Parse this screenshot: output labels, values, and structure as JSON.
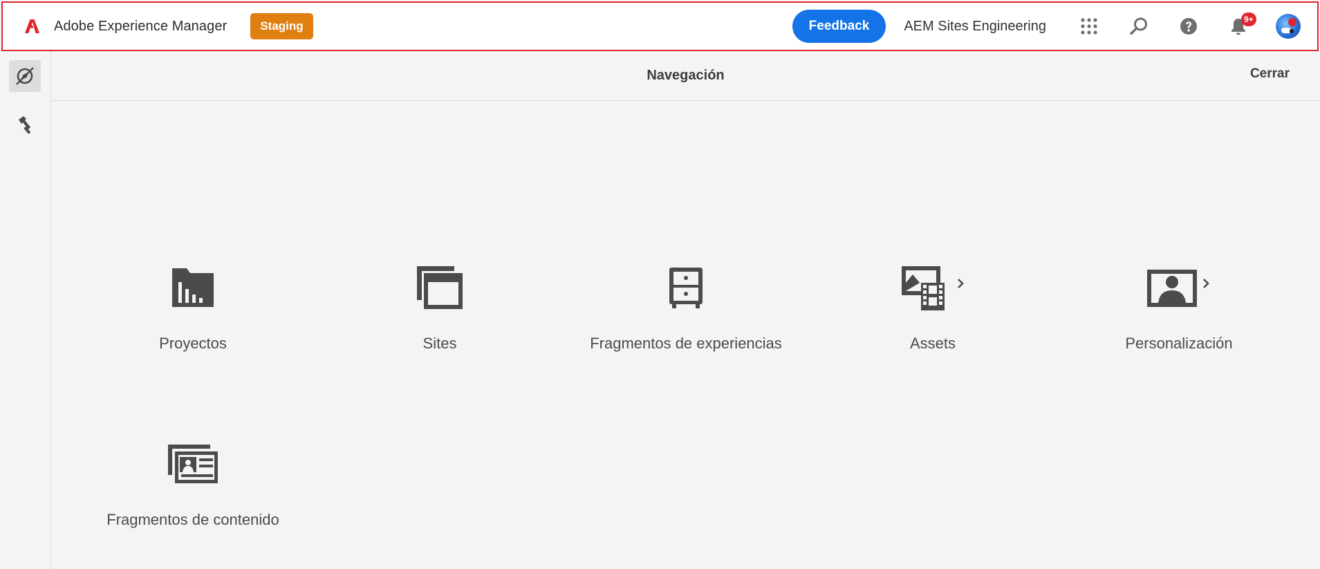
{
  "header": {
    "product_name": "Adobe Experience Manager",
    "environment_badge": "Staging",
    "feedback_label": "Feedback",
    "org_name": "AEM Sites Engineering",
    "notification_count": "9+",
    "icons": [
      "adobe-logo",
      "apps-grid-icon",
      "search-icon",
      "help-icon",
      "bell-icon",
      "avatar"
    ]
  },
  "rail": {
    "items": [
      {
        "name": "navigation",
        "icon": "compass-icon",
        "active": true
      },
      {
        "name": "tools",
        "icon": "hammer-icon",
        "active": false
      }
    ]
  },
  "panel": {
    "title": "Navegación",
    "close_label": "Cerrar"
  },
  "tiles": [
    {
      "label": "Proyectos",
      "icon": "projects-folder-icon",
      "has_submenu": false
    },
    {
      "label": "Sites",
      "icon": "sites-windows-icon",
      "has_submenu": false
    },
    {
      "label": "Fragmentos de experiencias",
      "icon": "experience-fragments-cabinet-icon",
      "has_submenu": false
    },
    {
      "label": "Assets",
      "icon": "assets-image-film-icon",
      "has_submenu": true
    },
    {
      "label": "Personalización",
      "icon": "personalization-person-icon",
      "has_submenu": true
    },
    {
      "label": "Fragmentos de contenido",
      "icon": "content-fragments-card-icon",
      "has_submenu": false
    }
  ],
  "colors": {
    "accent_blue": "#1473e6",
    "badge_orange": "#e08013",
    "alert_red": "#e0262f",
    "icon_gray": "#4b4b4b"
  }
}
